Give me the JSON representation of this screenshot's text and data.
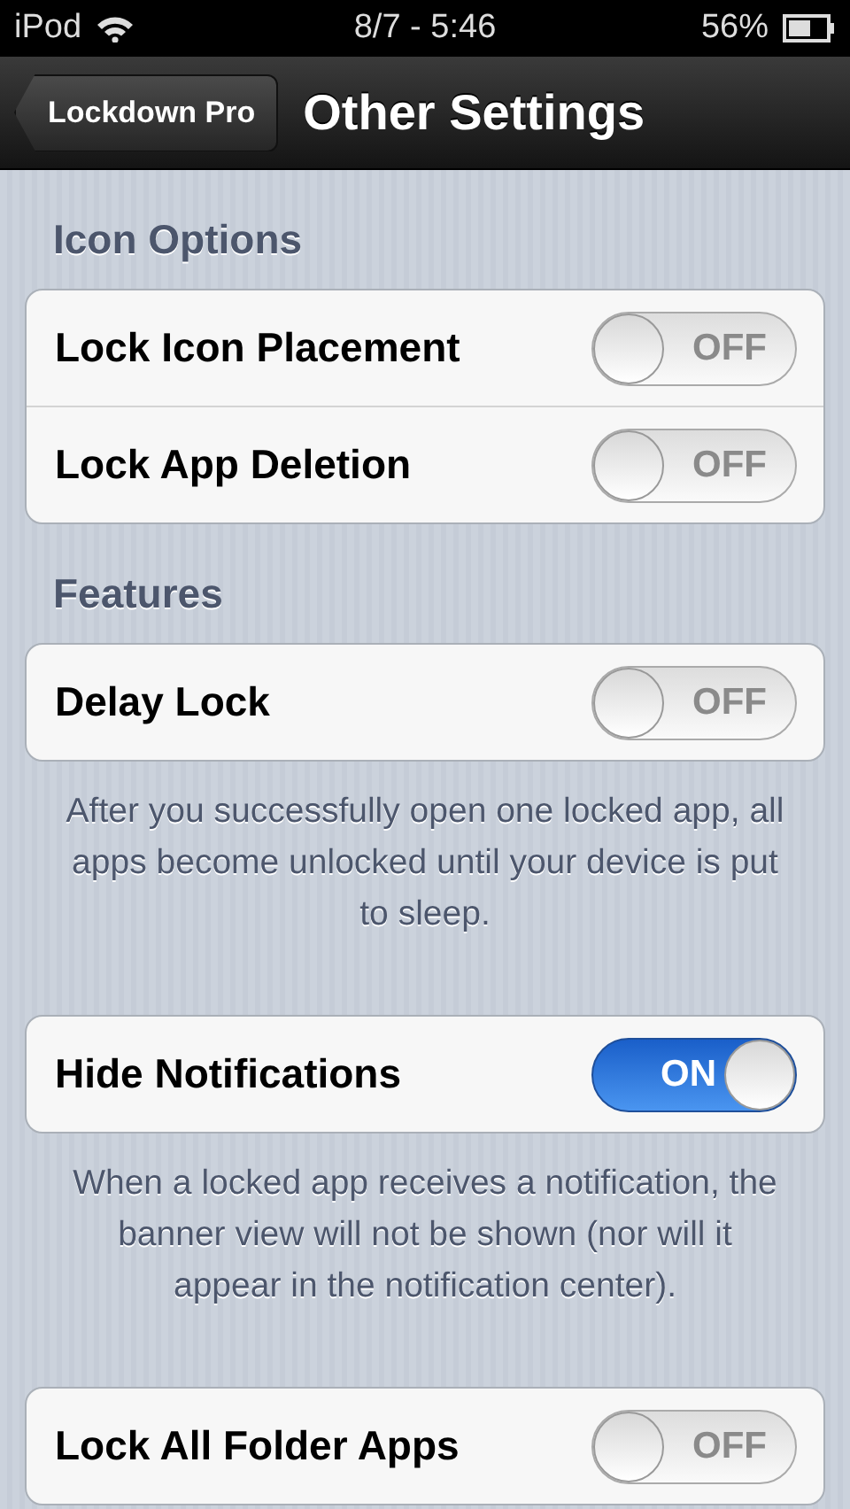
{
  "status_bar": {
    "carrier": "iPod",
    "time": "8/7 - 5:46",
    "battery": "56%"
  },
  "nav": {
    "back": "Lockdown Pro",
    "title": "Other Settings"
  },
  "sections": [
    {
      "header": "Icon Options",
      "rows": [
        {
          "label": "Lock Icon Placement",
          "on": false,
          "switch_text": "OFF"
        },
        {
          "label": "Lock App Deletion",
          "on": false,
          "switch_text": "OFF"
        }
      ]
    },
    {
      "header": "Features",
      "rows": [
        {
          "label": "Delay Lock",
          "on": false,
          "switch_text": "OFF"
        }
      ],
      "footer": "After you successfully open one locked app, all apps become unlocked until your device is put to sleep."
    },
    {
      "rows": [
        {
          "label": "Hide Notifications",
          "on": true,
          "switch_text": "ON"
        }
      ],
      "footer": "When a locked app receives a notification, the banner view will not be shown (nor will it appear in the notification center)."
    },
    {
      "rows": [
        {
          "label": "Lock All Folder Apps",
          "on": false,
          "switch_text": "OFF"
        }
      ]
    }
  ]
}
